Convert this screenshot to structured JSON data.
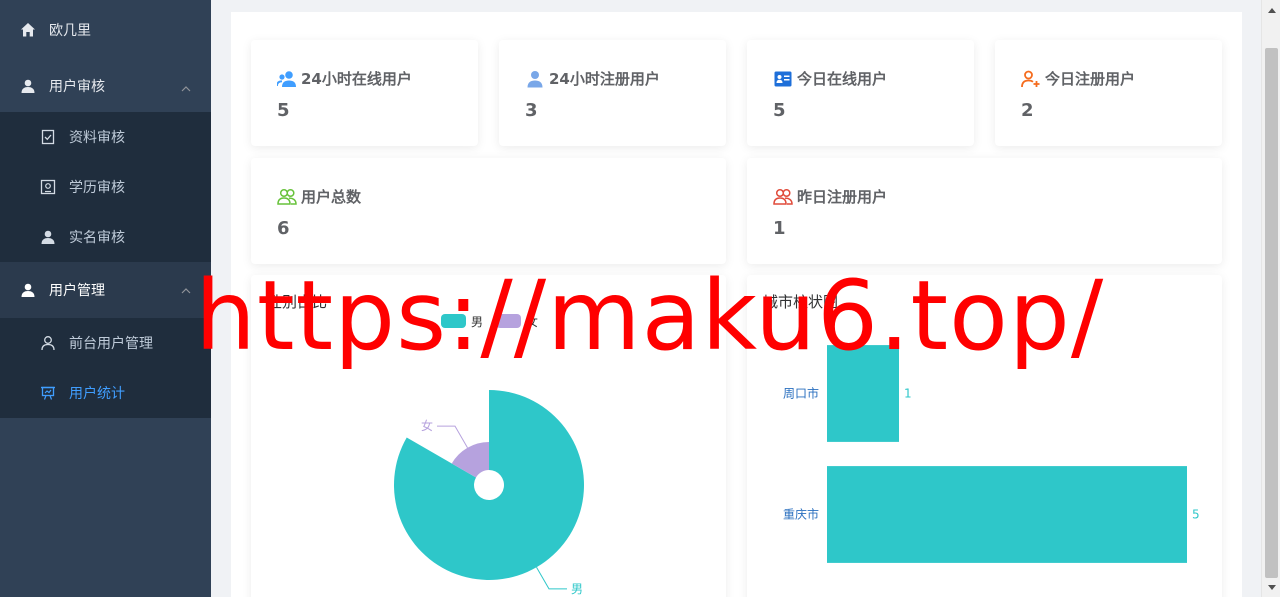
{
  "sidebar": {
    "home": {
      "label": "欧几里",
      "icon": "home-icon"
    },
    "audit": {
      "label": "用户审核",
      "icon": "user-icon",
      "items": [
        {
          "label": "资料审核",
          "icon": "document-check-icon"
        },
        {
          "label": "学历审核",
          "icon": "certificate-icon"
        },
        {
          "label": "实名审核",
          "icon": "user-solid-icon"
        }
      ]
    },
    "manage": {
      "label": "用户管理",
      "icon": "user-icon",
      "items": [
        {
          "label": "前台用户管理",
          "icon": "user-outline-icon"
        },
        {
          "label": "用户统计",
          "icon": "presentation-icon",
          "active": true
        }
      ]
    }
  },
  "stats": {
    "online_24h": {
      "label": "24小时在线用户",
      "value": "5",
      "icon": "users-icon",
      "color": "#409eff"
    },
    "register_24h": {
      "label": "24小时注册用户",
      "value": "3",
      "icon": "user-icon",
      "color": "#79a7e8"
    },
    "online_today": {
      "label": "今日在线用户",
      "value": "5",
      "icon": "id-card-icon",
      "color": "#1e6fd9"
    },
    "register_today": {
      "label": "今日注册用户",
      "value": "2",
      "icon": "user-add-icon",
      "color": "#f56c1e"
    },
    "total": {
      "label": "用户总数",
      "value": "6",
      "icon": "users-outline-icon",
      "color": "#67c23a"
    },
    "register_yesterday": {
      "label": "昨日注册用户",
      "value": "1",
      "icon": "users-outline-icon",
      "color": "#e04a3a"
    }
  },
  "chart_data": [
    {
      "type": "pie",
      "title": "性别占比",
      "labels": [
        "男",
        "女"
      ],
      "values": [
        5,
        1
      ],
      "colors": [
        "#2ec7c9",
        "#b6a2de"
      ],
      "legend": "top-center",
      "rose": true
    },
    {
      "type": "bar",
      "orientation": "horizontal",
      "title": "城市柱状图",
      "categories": [
        "周口市",
        "重庆市"
      ],
      "values": [
        1,
        5
      ],
      "color": "#2ec7c9",
      "xlim": [
        0,
        5
      ]
    }
  ],
  "watermark": "https://maku6.top/"
}
